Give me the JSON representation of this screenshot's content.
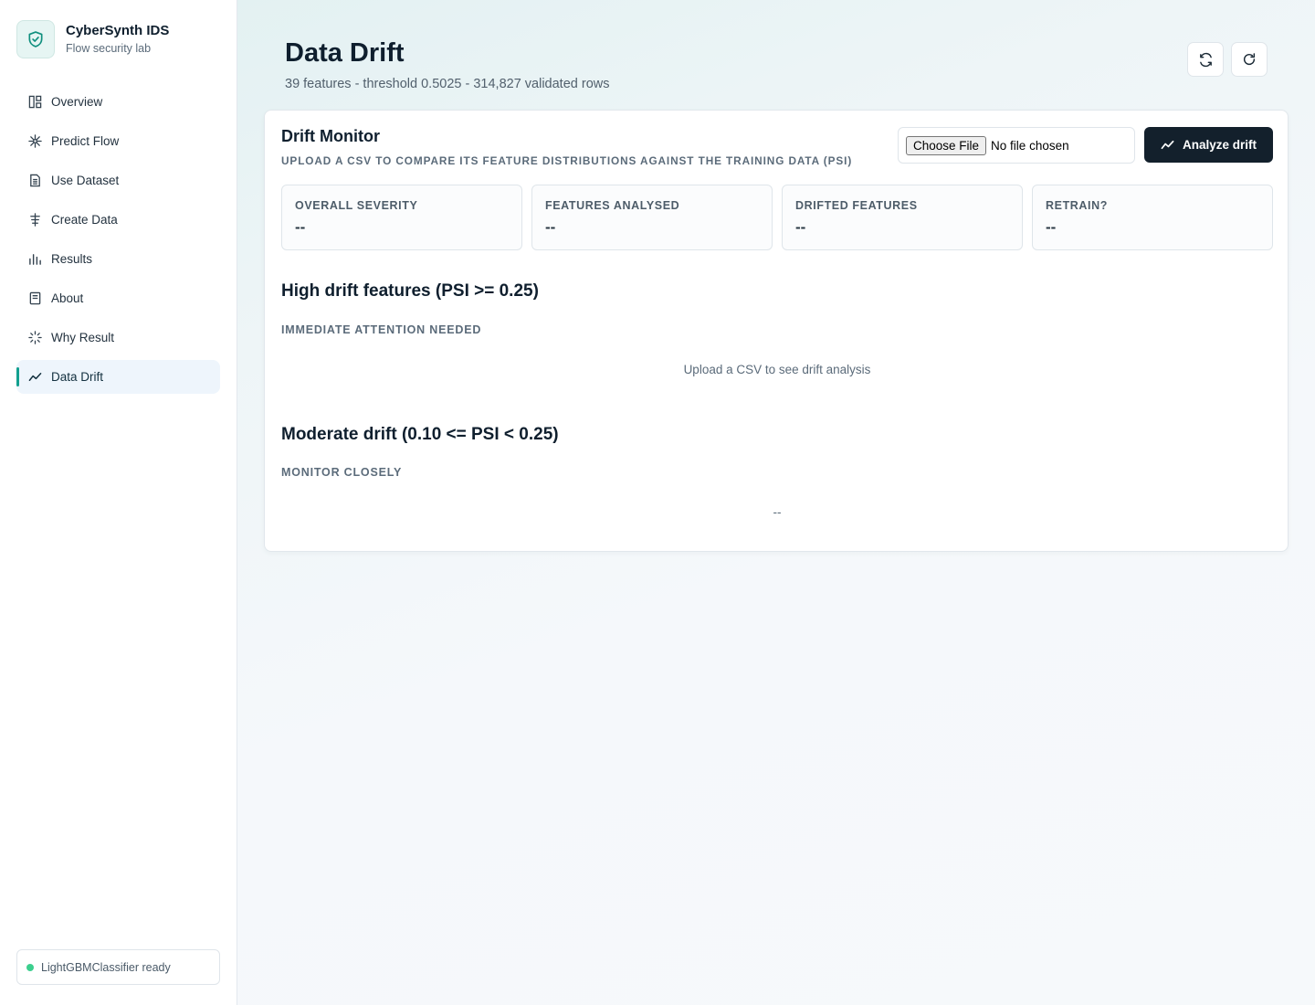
{
  "brand": {
    "name": "CyberSynth IDS",
    "subtitle": "Flow security lab"
  },
  "nav": {
    "items": [
      {
        "label": "Overview",
        "icon": "layout-icon"
      },
      {
        "label": "Predict Flow",
        "icon": "sparkle-icon"
      },
      {
        "label": "Use Dataset",
        "icon": "file-icon"
      },
      {
        "label": "Create Data",
        "icon": "signpost-icon"
      },
      {
        "label": "Results",
        "icon": "bar-chart-icon"
      },
      {
        "label": "About",
        "icon": "book-icon"
      },
      {
        "label": "Why Result",
        "icon": "loader-icon"
      },
      {
        "label": "Data Drift",
        "icon": "trend-icon",
        "active": true
      }
    ]
  },
  "status": {
    "text": "LightGBMClassifier ready",
    "color": "#3ccf8e"
  },
  "header": {
    "title": "Data Drift",
    "subtitle": "39 features - threshold 0.5025 - 314,827 validated rows",
    "buttons": [
      "sync-icon",
      "refresh-icon"
    ]
  },
  "monitor": {
    "title": "Drift Monitor",
    "subtitle": "Upload a CSV to compare its feature distributions against the training data (PSI)",
    "file_button": "Choose File",
    "file_status": "No file chosen",
    "analyze_label": "Analyze drift",
    "stats": [
      {
        "label": "Overall severity",
        "value": "--"
      },
      {
        "label": "Features analysed",
        "value": "--"
      },
      {
        "label": "Drifted features",
        "value": "--"
      },
      {
        "label": "Retrain?",
        "value": "--"
      }
    ],
    "high": {
      "title": "High drift features (PSI >= 0.25)",
      "subtitle": "Immediate attention needed",
      "empty": "Upload a CSV to see drift analysis"
    },
    "moderate": {
      "title": "Moderate drift (0.10 <= PSI < 0.25)",
      "subtitle": "Monitor closely",
      "empty": "--"
    }
  },
  "colors": {
    "accent": "#12a08f",
    "dark_button": "#13202c",
    "active_nav_bg": "#eef5fc"
  }
}
